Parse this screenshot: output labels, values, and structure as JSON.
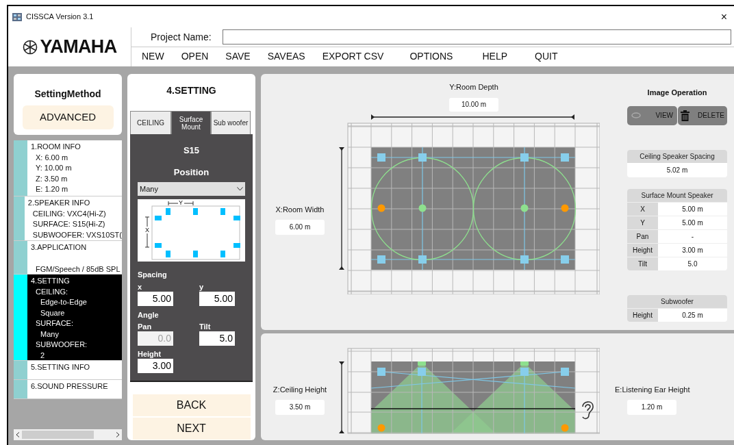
{
  "window": {
    "title": "CISSCA Version 3.1",
    "close": "×"
  },
  "header": {
    "logo": "YAMAHA",
    "project_label": "Project Name:",
    "menu": [
      "NEW",
      "OPEN",
      "SAVE",
      "SAVEAS",
      "EXPORT CSV",
      "OPTIONS",
      "HELP",
      "QUIT"
    ]
  },
  "setting_method": {
    "title": "SettingMethod",
    "value": "ADVANCED"
  },
  "steps": [
    {
      "title": "1.ROOM INFO",
      "selected": false,
      "items": [
        {
          "text": "X: 6.00 m"
        },
        {
          "text": "Y: 10.00 m"
        },
        {
          "text": "Z: 3.50 m"
        },
        {
          "text": "E: 1.20 m"
        }
      ]
    },
    {
      "title": "2.SPEAKER INFO",
      "selected": false,
      "items": [
        {
          "text": "CEILING: VXC4(Hi-Z)"
        },
        {
          "text": "SURFACE: S15(Hi-Z)"
        },
        {
          "text": "SUBWOOFER: VXS10ST("
        }
      ]
    },
    {
      "title": "3.APPLICATION",
      "selected": false,
      "items": [
        {
          "text": "FGM/Speech / 85dB SPL"
        }
      ]
    },
    {
      "title": "4.SETTING",
      "selected": true,
      "items": [
        {
          "text": "CEILING:",
          "children": [
            {
              "text": "Edge-to-Edge"
            },
            {
              "text": "Square"
            }
          ]
        },
        {
          "text": "SURFACE:",
          "children": [
            {
              "text": "Many"
            }
          ]
        },
        {
          "text": "SUBWOOFER:",
          "children": [
            {
              "text": "2"
            }
          ]
        }
      ]
    },
    {
      "title": "5.SETTING INFO",
      "selected": false
    },
    {
      "title": "6.SOUND PRESSURE",
      "selected": false
    }
  ],
  "setting": {
    "title": "4.SETTING",
    "tabs": [
      {
        "label": "CEILING",
        "selected": false
      },
      {
        "label": "Surface Mount",
        "selected": true
      },
      {
        "label": "Sub woofer",
        "selected": false
      }
    ],
    "model": "S15",
    "position_label": "Position",
    "position": "Many",
    "diagram": {
      "y_label": "Y",
      "x_label": "X"
    },
    "spacing_label": "Spacing",
    "angle_label": "Angle",
    "fields": [
      {
        "label": "x",
        "value": "5.00",
        "disabled": false
      },
      {
        "label": "y",
        "value": "5.00",
        "disabled": false
      },
      {
        "label": "Pan",
        "value": "0.0",
        "disabled": true
      },
      {
        "label": "Tilt",
        "value": "5.0",
        "disabled": false
      },
      {
        "label": "Height",
        "value": "3.00",
        "disabled": false
      }
    ],
    "buttons": [
      "BACK",
      "NEXT"
    ]
  },
  "plan": {
    "y_label": "Y:Room Depth",
    "y_value": "10.00 m",
    "x_label": "X:Room Width",
    "x_value": "6.00 m"
  },
  "image_operation": {
    "title": "Image Operation",
    "buttons": [
      "VIEW",
      "DELETE"
    ]
  },
  "ceiling_spacing": {
    "title": "Ceiling Speaker Spacing",
    "value": "5.02 m"
  },
  "surface_mount": {
    "title": "Surface Mount Speaker",
    "rows": [
      {
        "label": "X",
        "value": "5.00 m"
      },
      {
        "label": "Y",
        "value": "5.00 m"
      },
      {
        "label": "Pan",
        "value": "-"
      },
      {
        "label": "Height",
        "value": "3.00 m"
      },
      {
        "label": "Tilt",
        "value": "5.0"
      }
    ]
  },
  "subwoofer": {
    "title": "Subwoofer",
    "rows": [
      {
        "label": "Height",
        "value": "0.25 m"
      }
    ]
  },
  "elevation": {
    "z_label": "Z:Ceiling Height",
    "z_value": "3.50 m",
    "e_label": "E:Listening Ear Height",
    "e_value": "1.20 m"
  }
}
